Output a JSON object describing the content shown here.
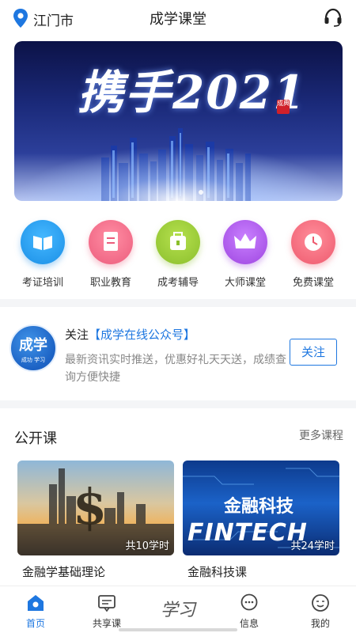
{
  "header": {
    "location": "江门市",
    "title": "成学课堂",
    "icons": {
      "location": "map-pin-icon",
      "support": "headset-icon"
    }
  },
  "banner": {
    "slogan": "携手2021",
    "seal_text": "成典"
  },
  "categories": [
    {
      "label": "考证培训",
      "icon": "book-icon",
      "color": "#2aa2f0"
    },
    {
      "label": "职业教育",
      "icon": "document-icon",
      "color": "#f2708a"
    },
    {
      "label": "成考辅导",
      "icon": "bag-icon",
      "color": "#9ccc38"
    },
    {
      "label": "大师课堂",
      "icon": "crown-icon",
      "color": "#b25fe6"
    },
    {
      "label": "免费课堂",
      "icon": "clock-icon",
      "color": "#f36b7d"
    }
  ],
  "follow": {
    "logo_text": "成学",
    "logo_sub": "成功 学习",
    "heading_prefix": "关注",
    "heading_account": "【成学在线公众号】",
    "description": "最新资讯实时推送，优惠好礼天天送，成绩查询方便快捷",
    "button_label": "关注"
  },
  "open_courses": {
    "title": "公开课",
    "more_label": "更多课程",
    "items": [
      {
        "name": "金融学基础理论",
        "hours": "共10学时"
      },
      {
        "name": "金融科技课",
        "hours": "共24学时",
        "thumb_title": "金融科技",
        "thumb_subtitle": "FINTECH"
      }
    ]
  },
  "tabbar": {
    "items": [
      {
        "label": "首页",
        "icon": "home-icon",
        "active": true
      },
      {
        "label": "共享课",
        "icon": "chat-board-icon",
        "active": false
      },
      {
        "label": "学习",
        "icon": "study-script-icon",
        "active": false
      },
      {
        "label": "信息",
        "icon": "message-icon",
        "active": false
      },
      {
        "label": "我的",
        "icon": "profile-icon",
        "active": false
      }
    ]
  },
  "colors": {
    "accent": "#1e77e0",
    "divider": "#f4f5f7"
  }
}
